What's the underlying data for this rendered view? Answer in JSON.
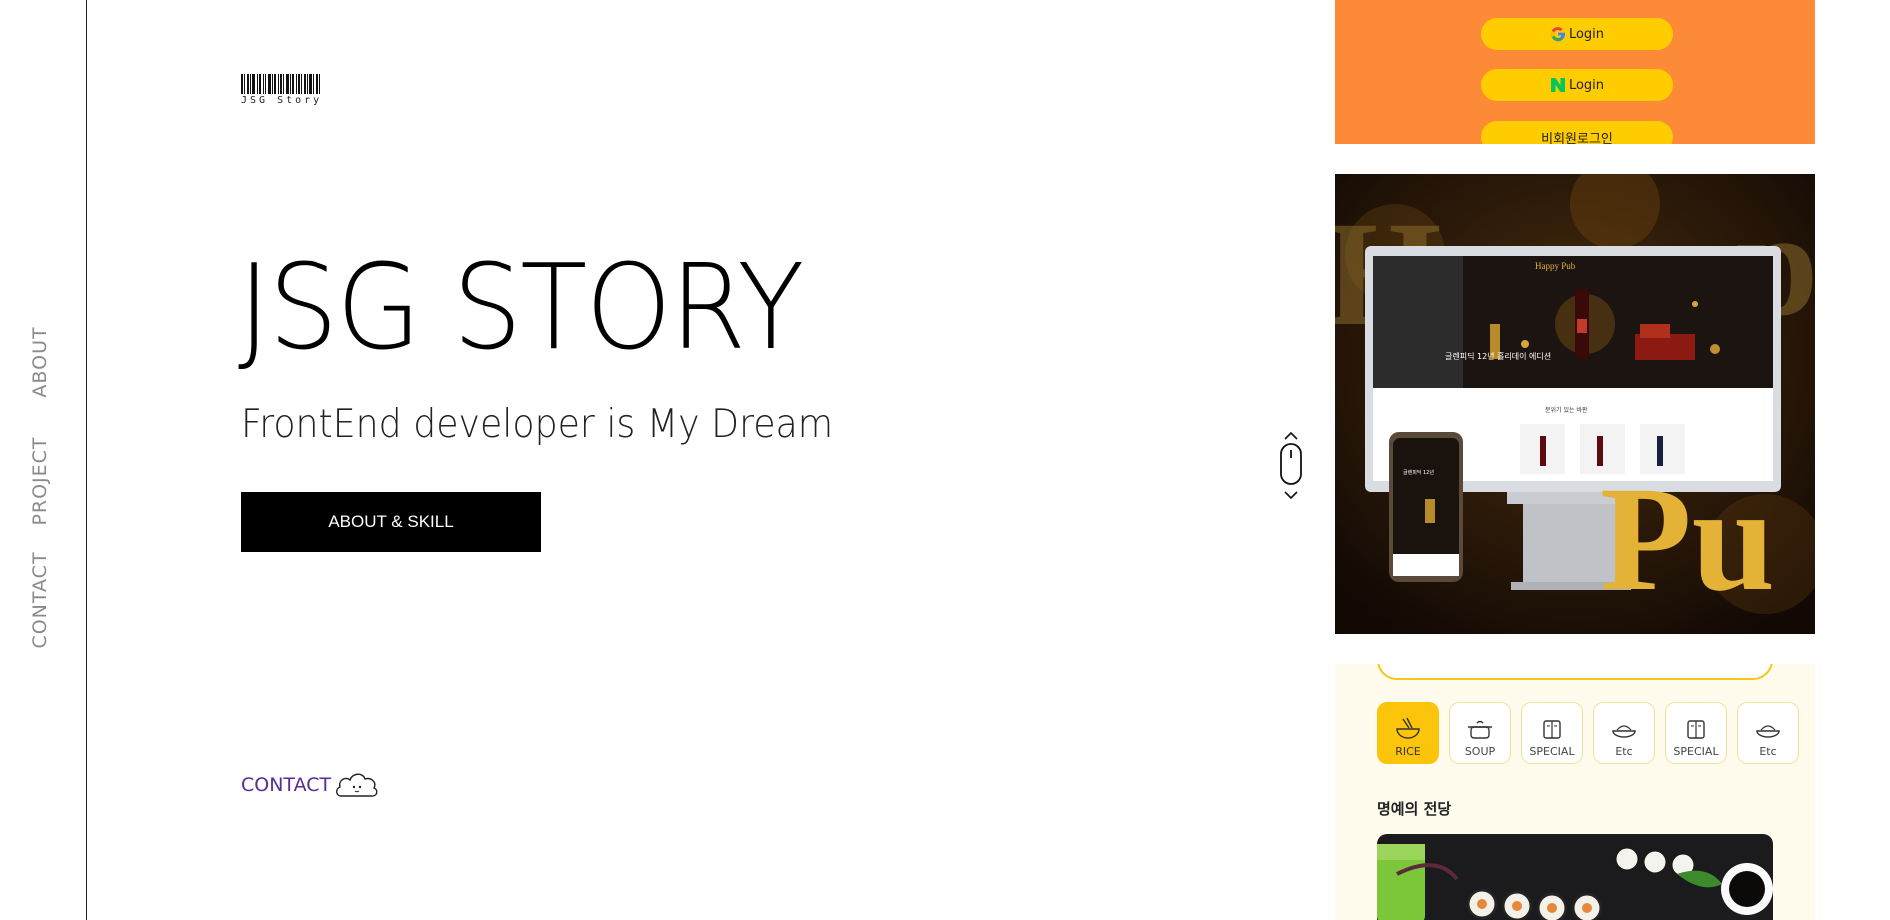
{
  "sidebar": {
    "items": [
      {
        "label": "ABOUT"
      },
      {
        "label": "PROJECT"
      },
      {
        "label": "CONTACT"
      }
    ]
  },
  "logo": {
    "text": "JSG Story"
  },
  "hero": {
    "title": "JSG STORY",
    "subtitle": "FrontEnd developer is My Dream",
    "button_label": "ABOUT & SKILL",
    "contact_label": "CONTACT"
  },
  "projects": {
    "login_panel": {
      "google_label": "Login",
      "naver_label": "Login",
      "guest_label": "비회원로그인"
    },
    "pub_panel": {
      "brand": "Happy Pub",
      "bg_word": "Pu",
      "banner_text": "글렌피딕 12년 홀리데이 에디션",
      "section_text": "분위기 있는 바판"
    },
    "food_panel": {
      "categories": [
        {
          "label": "RICE",
          "active": true
        },
        {
          "label": "SOUP",
          "active": false
        },
        {
          "label": "SPECIAL",
          "active": false
        },
        {
          "label": "Etc",
          "active": false
        },
        {
          "label": "SPECIAL",
          "active": false
        },
        {
          "label": "Etc",
          "active": false
        }
      ],
      "section_title": "명예의 전당"
    }
  },
  "colors": {
    "accent_purple": "#5b2c91",
    "login_bg": "#fd8a36",
    "login_button": "#ffcc00",
    "food_active": "#fdc40c",
    "pub_gold": "#e3b236"
  }
}
